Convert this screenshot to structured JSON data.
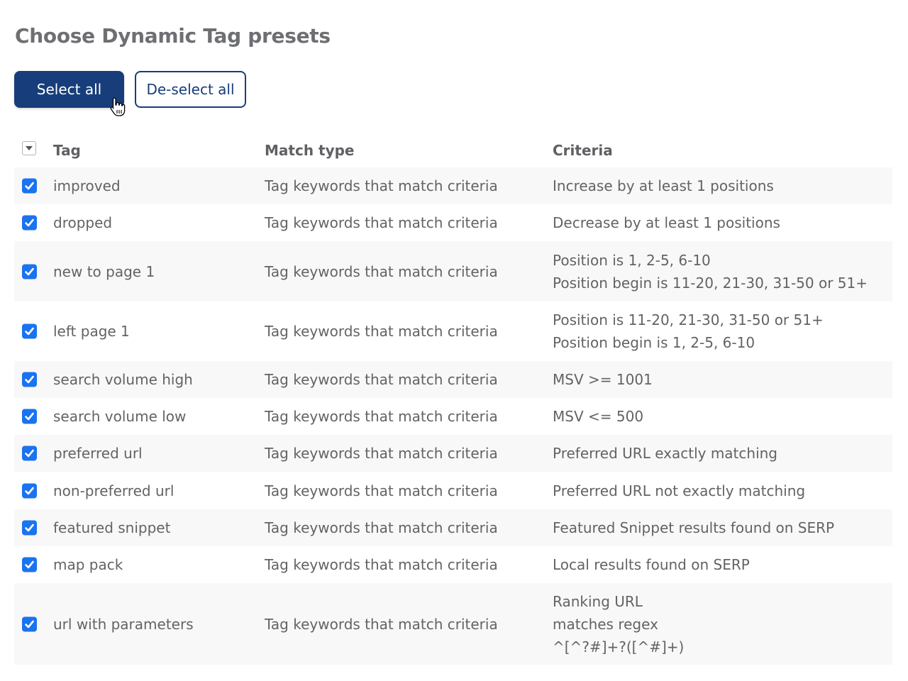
{
  "page": {
    "title": "Choose Dynamic Tag presets"
  },
  "toolbar": {
    "select_all_label": "Select all",
    "deselect_all_label": "De-select all"
  },
  "colors": {
    "primary": "#173e7a",
    "checkbox": "#1a73f0",
    "row_stripe": "#f8f8f8"
  },
  "table": {
    "columns": {
      "tag": "Tag",
      "match_type": "Match type",
      "criteria": "Criteria"
    },
    "rows": [
      {
        "checked": true,
        "tag": "improved",
        "match_type": "Tag keywords that match criteria",
        "criteria": [
          "Increase by at least 1 positions"
        ]
      },
      {
        "checked": true,
        "tag": "dropped",
        "match_type": "Tag keywords that match criteria",
        "criteria": [
          "Decrease by at least 1 positions"
        ]
      },
      {
        "checked": true,
        "tag": "new to page 1",
        "match_type": "Tag keywords that match criteria",
        "criteria": [
          "Position is 1, 2-5, 6-10",
          "Position begin is 11-20, 21-30, 31-50 or 51+"
        ]
      },
      {
        "checked": true,
        "tag": "left page 1",
        "match_type": "Tag keywords that match criteria",
        "criteria": [
          "Position is 11-20, 21-30, 31-50 or 51+",
          "Position begin is 1, 2-5, 6-10"
        ]
      },
      {
        "checked": true,
        "tag": "search volume high",
        "match_type": "Tag keywords that match criteria",
        "criteria": [
          "MSV >= 1001"
        ]
      },
      {
        "checked": true,
        "tag": "search volume low",
        "match_type": "Tag keywords that match criteria",
        "criteria": [
          "MSV <= 500"
        ]
      },
      {
        "checked": true,
        "tag": "preferred url",
        "match_type": "Tag keywords that match criteria",
        "criteria": [
          "Preferred URL exactly matching"
        ]
      },
      {
        "checked": true,
        "tag": "non-preferred url",
        "match_type": "Tag keywords that match criteria",
        "criteria": [
          "Preferred URL not exactly matching"
        ]
      },
      {
        "checked": true,
        "tag": "featured snippet",
        "match_type": "Tag keywords that match criteria",
        "criteria": [
          "Featured Snippet results found on SERP"
        ]
      },
      {
        "checked": true,
        "tag": "map pack",
        "match_type": "Tag keywords that match criteria",
        "criteria": [
          "Local results found on SERP"
        ]
      },
      {
        "checked": true,
        "tag": "url with parameters",
        "match_type": "Tag keywords that match criteria",
        "criteria": [
          "Ranking URL",
          "matches regex",
          "^[^?#]+?([^#]+)"
        ]
      }
    ]
  }
}
